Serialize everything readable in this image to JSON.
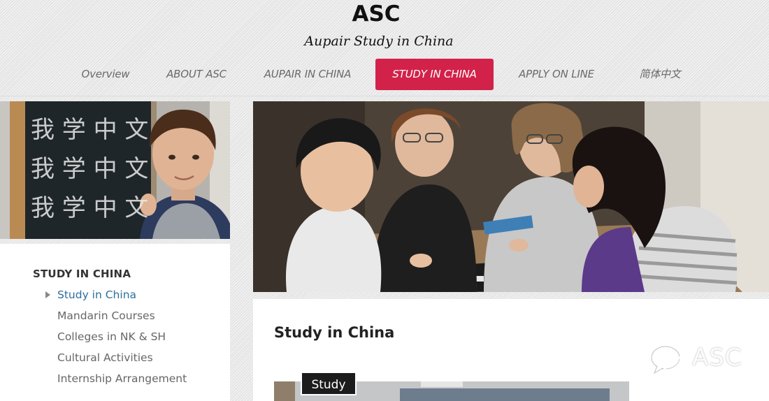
{
  "header": {
    "brand": "ASC",
    "tagline": "Aupair Study in China"
  },
  "nav": {
    "items": [
      {
        "label": "Overview",
        "active": false
      },
      {
        "label": "ABOUT ASC",
        "active": false
      },
      {
        "label": "AUPAIR IN CHINA",
        "active": false
      },
      {
        "label": "STUDY IN CHINA",
        "active": true
      },
      {
        "label": "APPLY ON LINE",
        "active": false
      },
      {
        "label": "简体中文",
        "active": false
      }
    ],
    "active_color": "#d2224a"
  },
  "sidebar": {
    "title": "STUDY IN CHINA",
    "links": [
      {
        "label": "Study in China",
        "current": true
      },
      {
        "label": "Mandarin Courses",
        "current": false
      },
      {
        "label": "Colleges in NK & SH",
        "current": false
      },
      {
        "label": "Cultural Activities",
        "current": false
      },
      {
        "label": "Internship Arrangement",
        "current": false
      }
    ],
    "photo": {
      "chalk_lines": [
        "我 学 中 文",
        "我 学 中 文",
        "我 学 中 文"
      ]
    }
  },
  "main": {
    "title": "Study in China",
    "image_tag": "Study"
  },
  "watermark": {
    "text": "ASC",
    "icon": "wechat-icon"
  }
}
